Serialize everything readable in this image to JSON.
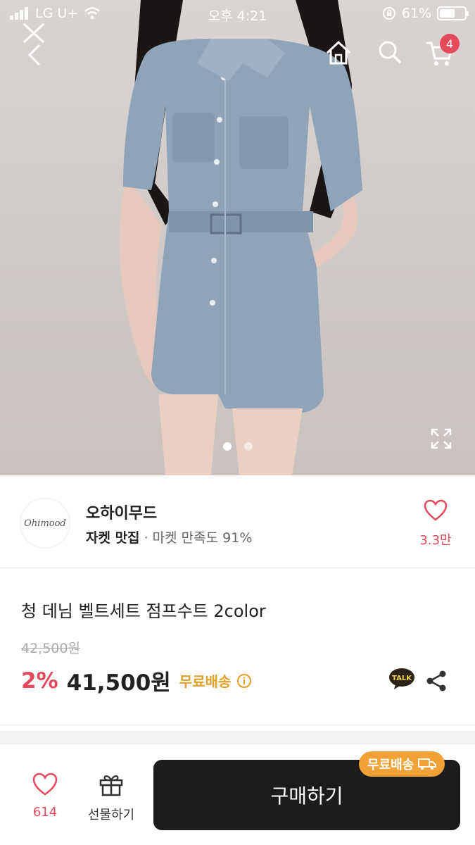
{
  "status_bar": {
    "carrier": "LG U+",
    "time": "오후 4:21",
    "battery": "61%",
    "battery_level": 0.61
  },
  "top_nav": {
    "cart_count": "4"
  },
  "carousel": {
    "total": 2,
    "active": 1
  },
  "seller": {
    "logo_text": "Ohimood",
    "name": "오하이무드",
    "category": "자켓 맛집",
    "satisfaction": "· 마켓 만족도 91%",
    "likes": "3.3만"
  },
  "product": {
    "title": "청 데님 벨트세트 점프수트 2color",
    "original_price": "42,500원",
    "discount": "2%",
    "price": "41,500원",
    "shipping": "무료배송",
    "talk_label": "TALK"
  },
  "bottom_bar": {
    "like_count": "614",
    "gift_label": "선물하기",
    "buy_label": "구매하기",
    "free_shipping_tag": "무료배송"
  },
  "colors": {
    "accent": "#e4495c",
    "shipping": "#e0a02a",
    "buy_button": "#1c1c1c",
    "tag": "#f0a236"
  }
}
